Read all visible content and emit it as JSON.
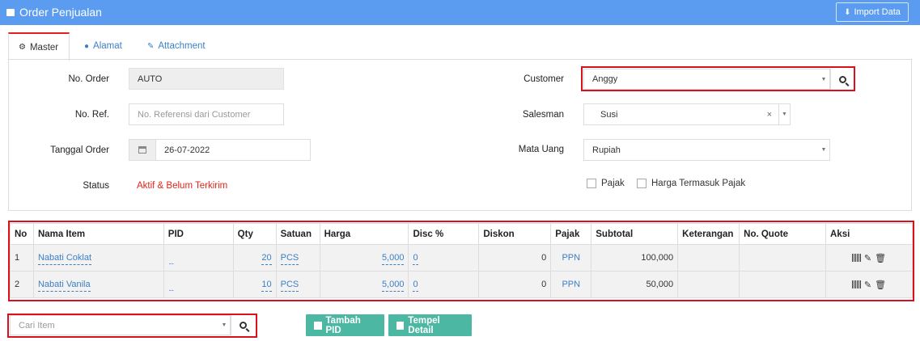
{
  "header": {
    "title": "Order Penjualan",
    "import_label": "Import Data"
  },
  "tabs": [
    {
      "label": "Master",
      "icon": "cogs-icon"
    },
    {
      "label": "Alamat",
      "icon": "map-marker-icon"
    },
    {
      "label": "Attachment",
      "icon": "paperclip-icon"
    }
  ],
  "form": {
    "no_order_label": "No. Order",
    "no_order_value": "AUTO",
    "no_ref_label": "No. Ref.",
    "no_ref_placeholder": "No. Referensi dari Customer",
    "tanggal_label": "Tanggal Order",
    "tanggal_value": "26-07-2022",
    "status_label": "Status",
    "status_value": "Aktif & Belum Terkirim",
    "customer_label": "Customer",
    "customer_value": "Anggy",
    "salesman_label": "Salesman",
    "salesman_value": "Susi",
    "mata_uang_label": "Mata Uang",
    "mata_uang_value": "Rupiah",
    "pajak_label": "Pajak",
    "harga_pajak_label": "Harga Termasuk Pajak"
  },
  "table": {
    "headers": [
      "No",
      "Nama Item",
      "PID",
      "Qty",
      "Satuan",
      "Harga",
      "Disc %",
      "Diskon",
      "Pajak",
      "Subtotal",
      "Keterangan",
      "No. Quote",
      "Aksi"
    ],
    "rows": [
      {
        "no": "1",
        "item": "Nabati Coklat",
        "pid": "--",
        "qty": "20",
        "satuan": "PCS",
        "harga": "5,000",
        "disc": "0",
        "diskon": "0",
        "pajak": "PPN",
        "subtotal": "100,000",
        "keterangan": "",
        "quote": ""
      },
      {
        "no": "2",
        "item": "Nabati Vanila",
        "pid": "--",
        "qty": "10",
        "satuan": "PCS",
        "harga": "5,000",
        "disc": "0",
        "diskon": "0",
        "pajak": "PPN",
        "subtotal": "50,000",
        "keterangan": "",
        "quote": ""
      }
    ]
  },
  "bottom": {
    "cari_item_placeholder": "Cari Item",
    "tambah_pid_label": "Tambah PID",
    "tempel_detail_label": "Tempel Detail"
  },
  "colors": {
    "header": "#5b9cf0",
    "accent_red": "#d9111c",
    "button_green": "#4cb8a3",
    "link": "#3c7fc6"
  }
}
